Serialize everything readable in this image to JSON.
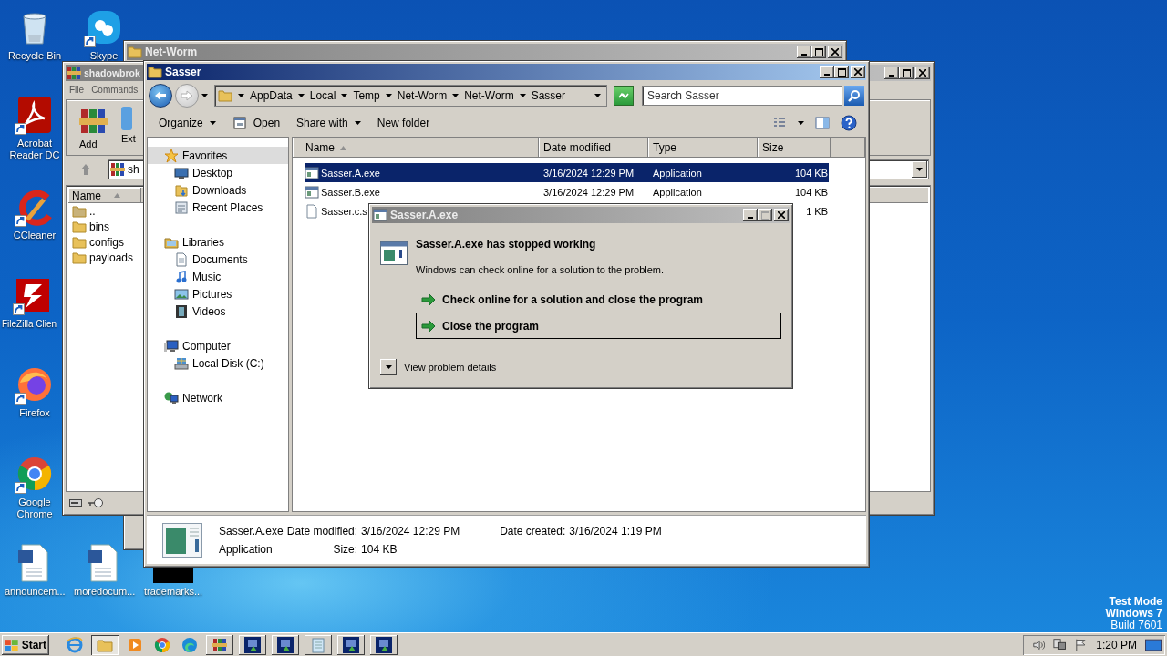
{
  "desktop_icons": [
    {
      "label": "Recycle Bin",
      "shortcut": false
    },
    {
      "label": "Skype",
      "shortcut": true
    },
    {
      "label": "Acrobat Reader DC",
      "shortcut": true
    },
    {
      "label": "CCleaner",
      "shortcut": true
    },
    {
      "label": "FileZilla Clien",
      "shortcut": true
    },
    {
      "label": "Firefox",
      "shortcut": true
    },
    {
      "label": "Google Chrome",
      "shortcut": true
    },
    {
      "label": "announcem...",
      "shortcut": false
    },
    {
      "label": "moredocum...",
      "shortcut": false
    },
    {
      "label": "trademarks...",
      "shortcut": false
    }
  ],
  "back_window": {
    "title": "Net-Worm",
    "active": false
  },
  "archive_window": {
    "title": "shadowbrok",
    "active": false,
    "menu": [
      "File",
      "Commands"
    ],
    "tools": [
      "Add",
      "Ext"
    ],
    "address": "sh",
    "list_header": {
      "label": "Name",
      "sorted": true
    },
    "files": [
      {
        "name": "..",
        "kind": "parent"
      },
      {
        "name": "bins",
        "kind": "folder"
      },
      {
        "name": "configs",
        "kind": "folder"
      },
      {
        "name": "payloads",
        "kind": "folder"
      }
    ]
  },
  "explorer_window": {
    "title": "Sasser",
    "active": true,
    "breadcrumb": [
      "AppData",
      "Local",
      "Temp",
      "Net-Worm",
      "Net-Worm",
      "Sasser"
    ],
    "search": {
      "placeholder": "Search Sasser"
    },
    "commands": [
      {
        "label": "Organize",
        "dropdown": true,
        "kind": "menu"
      },
      {
        "label": "Open",
        "dropdown": false,
        "kind": "open"
      },
      {
        "label": "Share with",
        "dropdown": true,
        "kind": "menu"
      },
      {
        "label": "New folder",
        "dropdown": false,
        "kind": "menu"
      }
    ],
    "nav": [
      {
        "label": "Favorites",
        "kind": "star",
        "selected": true,
        "children": [
          {
            "label": "Desktop",
            "kind": "desktop",
            "selected": false
          },
          {
            "label": "Downloads",
            "kind": "downloads",
            "selected": false
          },
          {
            "label": "Recent Places",
            "kind": "recent",
            "selected": false
          }
        ]
      },
      {
        "label": "Libraries",
        "kind": "libraries",
        "selected": false,
        "children": [
          {
            "label": "Documents",
            "kind": "documents",
            "selected": false
          },
          {
            "label": "Music",
            "kind": "music",
            "selected": false
          },
          {
            "label": "Pictures",
            "kind": "pictures",
            "selected": false
          },
          {
            "label": "Videos",
            "kind": "videos",
            "selected": false
          }
        ]
      },
      {
        "label": "Computer",
        "kind": "computer",
        "selected": false,
        "children": [
          {
            "label": "Local Disk (C:)",
            "kind": "disk",
            "selected": false
          }
        ]
      },
      {
        "label": "Network",
        "kind": "network",
        "selected": false
      }
    ],
    "columns": [
      {
        "label": "Name",
        "sorted": true
      },
      {
        "label": "Date modified",
        "sorted": false
      },
      {
        "label": "Type",
        "sorted": false
      },
      {
        "label": "Size",
        "sorted": false
      }
    ],
    "rows": [
      {
        "name": "Sasser.A.exe",
        "date": "3/16/2024 12:29 PM",
        "type": "Application",
        "size": "104 KB",
        "kind": "app",
        "selected": true
      },
      {
        "name": "Sasser.B.exe",
        "date": "3/16/2024 12:29 PM",
        "type": "Application",
        "size": "104 KB",
        "kind": "app",
        "selected": false
      },
      {
        "name": "Sasser.c.s",
        "size": "1 KB",
        "kind": "file",
        "selected": false
      }
    ],
    "details": {
      "lines": [
        {
          "name": "Sasser.A.exe",
          "fields": [
            {
              "label": "Date modified:",
              "value": "3/16/2024 12:29 PM"
            },
            {
              "label": "Date created:",
              "value": "3/16/2024 1:19 PM"
            }
          ]
        },
        {
          "name": "Application",
          "fields": [
            {
              "label": "Size:",
              "value": "104 KB"
            }
          ]
        }
      ]
    }
  },
  "error_dialog": {
    "title": "Sasser.A.exe",
    "active": false,
    "maximize_disabled": true,
    "heading": "Sasser.A.exe has stopped working",
    "message": "Windows can check online for a solution to the problem.",
    "options": [
      {
        "label": "Check online for a solution and close the program",
        "focused": false
      },
      {
        "label": "Close the program",
        "focused": true
      }
    ],
    "details_toggle": "View problem details"
  },
  "taskbar": {
    "start": "Start",
    "items": [
      {
        "kind": "launcher",
        "pressed": false
      },
      {
        "kind": "task",
        "pressed": true
      },
      {
        "kind": "launcher",
        "pressed": false
      },
      {
        "kind": "launcher",
        "pressed": false
      },
      {
        "kind": "launcher",
        "pressed": false
      },
      {
        "kind": "task",
        "pressed": false
      },
      {
        "kind": "task",
        "pressed": false
      },
      {
        "kind": "task",
        "pressed": false
      },
      {
        "kind": "task",
        "pressed": false
      },
      {
        "kind": "task",
        "pressed": false
      },
      {
        "kind": "task",
        "pressed": false
      }
    ],
    "clock": "1:20 PM"
  },
  "os_notice": [
    {
      "text": "Test Mode",
      "bold": true
    },
    {
      "text": "Windows 7",
      "bold": true
    },
    {
      "text": "Build 7601",
      "bold": false
    }
  ]
}
